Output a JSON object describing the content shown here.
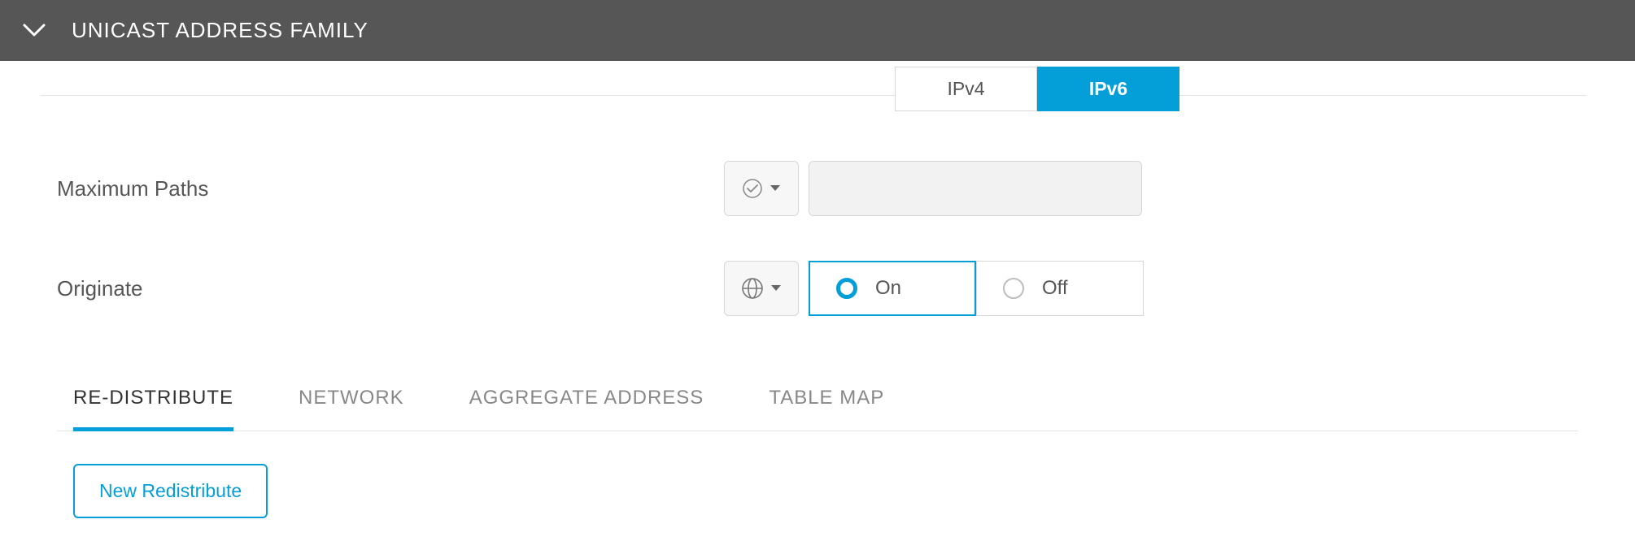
{
  "header": {
    "title": "UNICAST ADDRESS FAMILY"
  },
  "ipTabs": {
    "ipv4": "IPv4",
    "ipv6": "IPv6",
    "active": "ipv6"
  },
  "form": {
    "maxPaths": {
      "label": "Maximum Paths",
      "value": ""
    },
    "originate": {
      "label": "Originate",
      "on": "On",
      "off": "Off",
      "selected": "on"
    }
  },
  "subTabs": {
    "redistribute": "RE-DISTRIBUTE",
    "network": "NETWORK",
    "aggregate": "AGGREGATE ADDRESS",
    "tableMap": "TABLE MAP",
    "active": "redistribute"
  },
  "actions": {
    "newRedistribute": "New Redistribute"
  }
}
